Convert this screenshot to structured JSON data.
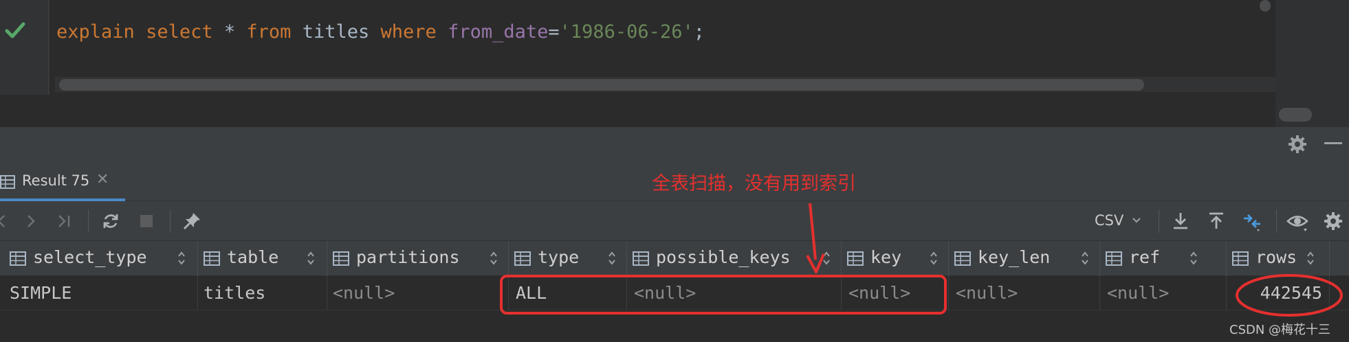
{
  "editor": {
    "query": {
      "t1": "explain",
      "t2": "select",
      "t3": "*",
      "t4": "from",
      "t5": "titles",
      "t6": "where",
      "t7": "from_date",
      "t8": "=",
      "t9": "'1986-06-26'",
      "t10": ";"
    },
    "gutter_icon": "check-icon"
  },
  "tabs": [
    {
      "label": "Result 75",
      "icon": "table-icon",
      "close": "✕"
    }
  ],
  "toolbar": {
    "export_format": "CSV",
    "icons": [
      "previous-page-icon",
      "next-page-icon",
      "last-page-icon",
      "refresh-icon",
      "stop-icon",
      "pin-icon",
      "download-icon",
      "upload-icon",
      "compare-icon",
      "view-icon",
      "settings-icon"
    ]
  },
  "grid": {
    "columns": [
      "select_type",
      "table",
      "partitions",
      "type",
      "possible_keys",
      "key",
      "key_len",
      "ref",
      "rows"
    ],
    "row": {
      "select_type": "SIMPLE",
      "table": "titles",
      "partitions": "<null>",
      "type": "ALL",
      "possible_keys": "<null>",
      "key": "<null>",
      "key_len": "<null>",
      "ref": "<null>",
      "rows": "442545"
    }
  },
  "annotation": {
    "text": "全表扫描，没有用到索引",
    "color": "#e5302f"
  },
  "watermark": "CSDN @梅花十三",
  "colors": {
    "accent": "#4a88c7",
    "keyword": "#cc7832",
    "string": "#6a8759",
    "column": "#9876aa"
  }
}
